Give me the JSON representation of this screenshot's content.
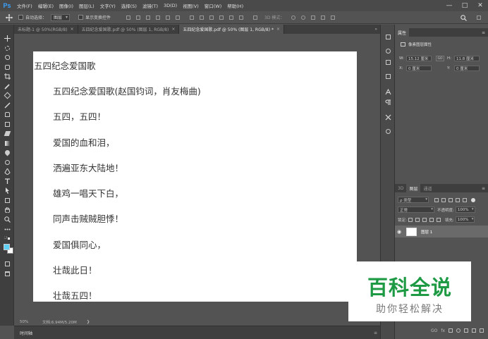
{
  "app": {
    "logo": "Ps"
  },
  "menu": [
    "文件(F)",
    "编辑(E)",
    "图像(I)",
    "图层(L)",
    "文字(Y)",
    "选择(S)",
    "滤镜(T)",
    "3D(D)",
    "视图(V)",
    "窗口(W)",
    "帮助(H)"
  ],
  "window_controls": {
    "minimize": "—",
    "maximize": "□",
    "close": "✕"
  },
  "options": {
    "auto_select_label": "自动选择：",
    "auto_select_value": "图层",
    "show_transform_label": "显示变换控件",
    "mode_3d_label": "3D 模式："
  },
  "tabs": [
    {
      "label": "未标题-1 @ 50%(RGB/8)",
      "close": "×"
    },
    {
      "label": "五四纪念爱国歌.pdf @ 50% (图层 1, RGB/8)",
      "close": "×"
    },
    {
      "label": "五四纪念爱国歌.pdf @ 50% (图层 1, RGB/8) *",
      "close": "×"
    }
  ],
  "tabs_overflow": "»",
  "document": {
    "title": "五四纪念爱国歌",
    "lines": [
      "五四纪念爱国歌(赵国钧词，肖友梅曲)",
      "五四，五四！",
      "爱国的血和泪，",
      "洒遍亚东大陆地！",
      "雄鸡一唱天下白，",
      "同声击贼贼胆悸！",
      "爱国俱同心，",
      "壮哉此日！",
      "壮哉五四！"
    ]
  },
  "status": {
    "zoom": "50%",
    "doc_info": "文档:6.94M/5.20M",
    "arrow": "❯"
  },
  "timeline": {
    "label": "时间轴",
    "menu": "≡"
  },
  "properties": {
    "tab": "属性",
    "menu": "≡",
    "subtitle": "像素图层属性",
    "w_label": "W:",
    "w_value": "15.12 厘米",
    "link": "GO",
    "h_label": "H:",
    "h_value": "11.8 厘米",
    "x_label": "X:",
    "x_value": "0 厘米",
    "y_label": "Y:",
    "y_value": "0 厘米"
  },
  "layers_panel": {
    "tabs": [
      "3D",
      "图层",
      "通道"
    ],
    "menu": "≡",
    "filter_value": "ρ 类型",
    "blend_mode": "正常",
    "opacity_label": "不透明度:",
    "opacity_value": "100%",
    "lock_label": "锁定:",
    "fill_label": "填充:",
    "fill_value": "100%",
    "layer_name": "图层 1",
    "eye": "◉",
    "footer": [
      "GO",
      "fx"
    ]
  },
  "watermark": {
    "main": "百科全说",
    "sub": "助你轻松解决"
  }
}
